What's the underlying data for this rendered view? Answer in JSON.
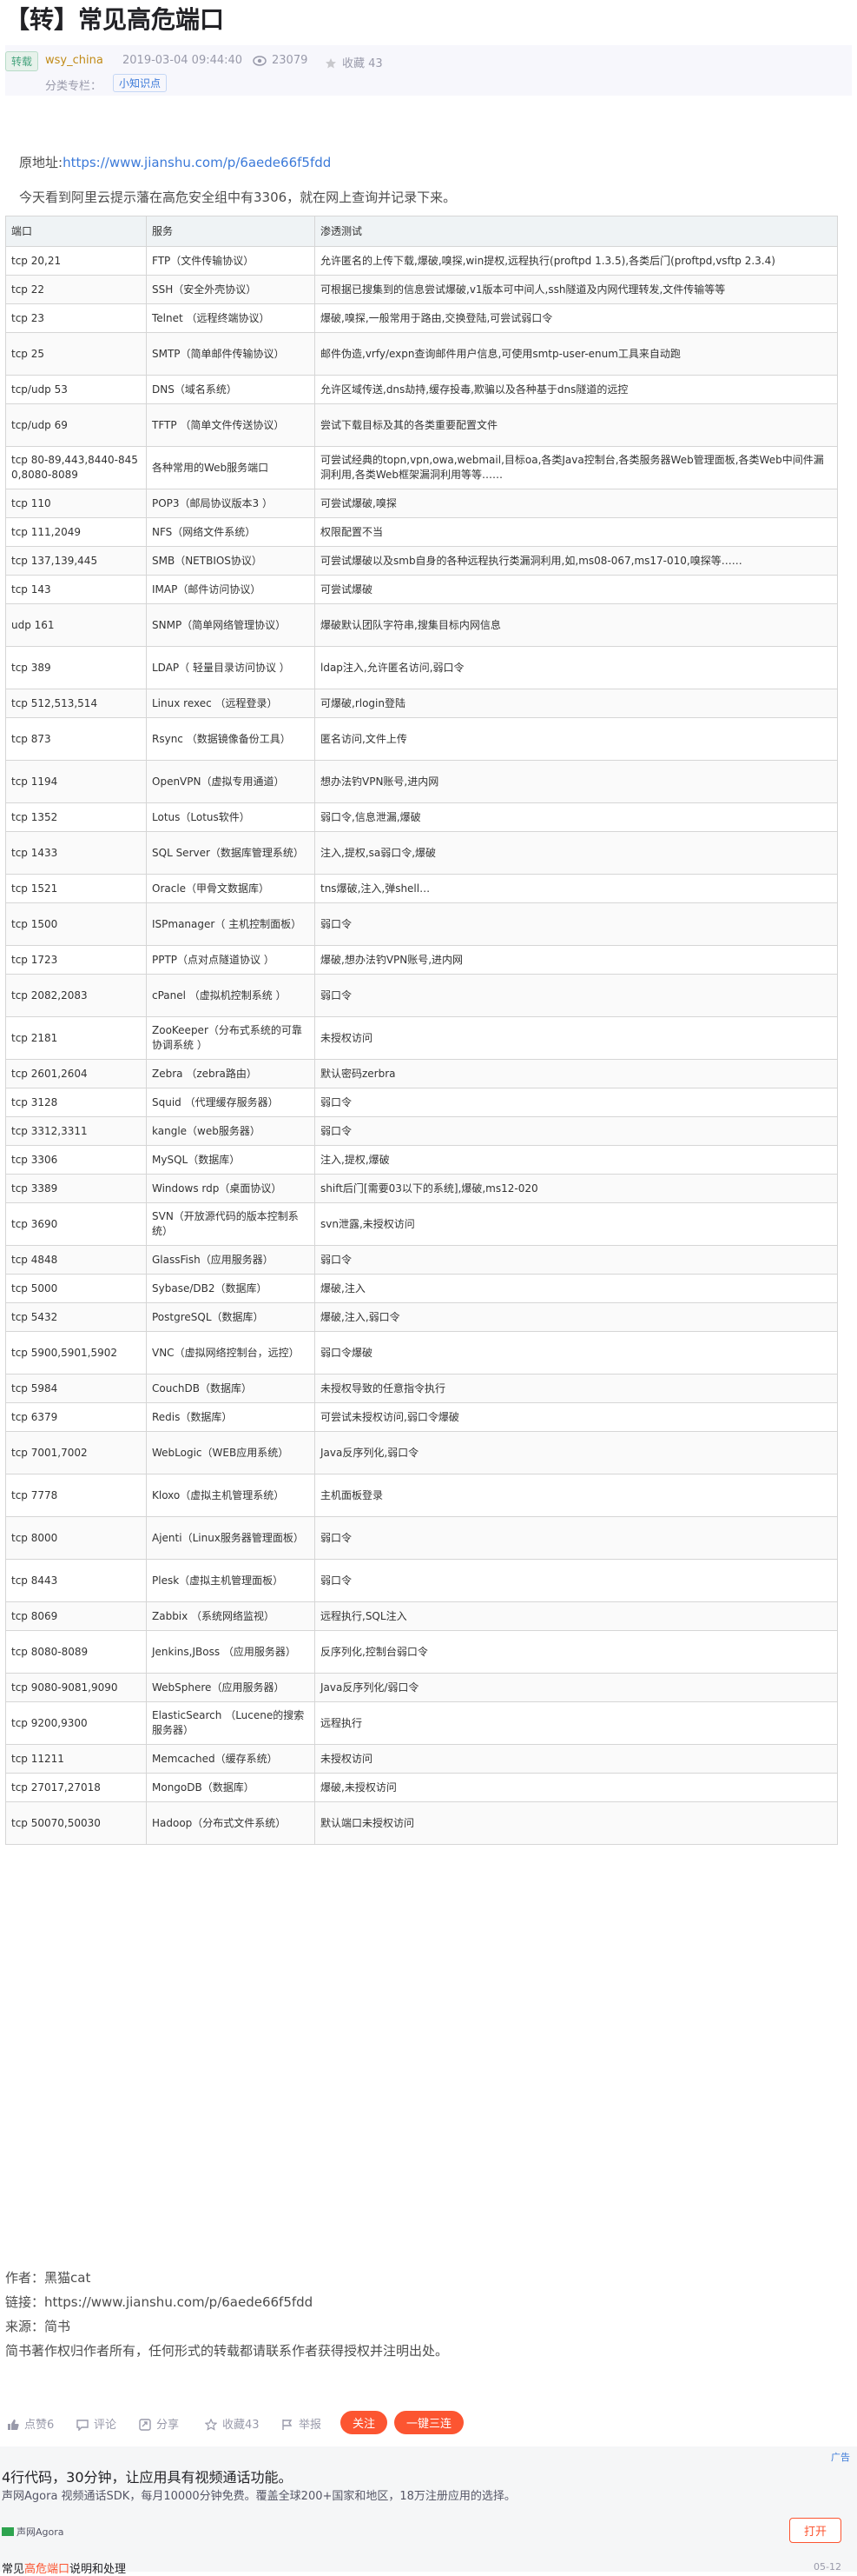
{
  "article": {
    "title": "【转】常见高危端口",
    "tag": "转载",
    "author": "wsy_china",
    "time": "2019-03-04 09:44:40",
    "views": "23079",
    "collect": "收藏 43",
    "column_label": "分类专栏：",
    "column_link": "小知识点",
    "origin_prefix": "原地址:",
    "origin_url": "https://www.jianshu.com/p/6aede66f5fdd",
    "intro": "今天看到阿里云提示藩在高危安全组中有3306，就在网上查询并记录下来。"
  },
  "table": {
    "headers": [
      "端口",
      "服务",
      "渗透测试"
    ],
    "rows": [
      [
        "tcp 20,21",
        "FTP（文件传输协议）",
        "允许匿名的上传下载,爆破,嗅探,win提权,远程执行(proftpd 1.3.5),各类后门(proftpd,vsftp 2.3.4)"
      ],
      [
        "tcp 22",
        "SSH（安全外壳协议）",
        "可根据已搜集到的信息尝试爆破,v1版本可中间人,ssh隧道及内网代理转发,文件传输等等"
      ],
      [
        "tcp 23",
        "Telnet （远程终端协议）",
        "爆破,嗅探,一般常用于路由,交换登陆,可尝试弱口令"
      ],
      [
        "tcp 25",
        "SMTP（简单邮件传输协议）",
        "邮件伪造,vrfy/expn查询邮件用户信息,可使用smtp-user-enum工具来自动跑"
      ],
      [
        "tcp/udp 53",
        "DNS（域名系统）",
        "允许区域传送,dns劫持,缓存投毒,欺骗以及各种基于dns隧道的远控"
      ],
      [
        "tcp/udp 69",
        "TFTP （简单文件传送协议）",
        "尝试下载目标及其的各类重要配置文件"
      ],
      [
        "tcp 80-89,443,8440-8450,8080-8089",
        "各种常用的Web服务端口",
        "可尝试经典的topn,vpn,owa,webmail,目标oa,各类Java控制台,各类服务器Web管理面板,各类Web中间件漏洞利用,各类Web框架漏洞利用等等……"
      ],
      [
        "tcp 110",
        "POP3（邮局协议版本3 ）",
        "可尝试爆破,嗅探"
      ],
      [
        "tcp 111,2049",
        "NFS（网络文件系统）",
        "权限配置不当"
      ],
      [
        "tcp 137,139,445",
        "SMB（NETBIOS协议）",
        "可尝试爆破以及smb自身的各种远程执行类漏洞利用,如,ms08-067,ms17-010,嗅探等……"
      ],
      [
        "tcp 143",
        "IMAP（邮件访问协议）",
        "可尝试爆破"
      ],
      [
        "udp 161",
        "SNMP（简单网络管理协议）",
        "爆破默认团队字符串,搜集目标内网信息"
      ],
      [
        "tcp 389",
        "LDAP（ 轻量目录访问协议 ）",
        "ldap注入,允许匿名访问,弱口令"
      ],
      [
        "tcp 512,513,514",
        "Linux rexec （远程登录）",
        "可爆破,rlogin登陆"
      ],
      [
        "tcp 873",
        "Rsync （数据镜像备份工具）",
        "匿名访问,文件上传"
      ],
      [
        "tcp 1194",
        "OpenVPN（虚拟专用通道）",
        "想办法钓VPN账号,进内网"
      ],
      [
        "tcp 1352",
        "Lotus（Lotus软件）",
        "弱口令,信息泄漏,爆破"
      ],
      [
        "tcp 1433",
        "SQL Server（数据库管理系统）",
        "注入,提权,sa弱口令,爆破"
      ],
      [
        "tcp 1521",
        "Oracle（甲骨文数据库）",
        "tns爆破,注入,弹shell…"
      ],
      [
        "tcp 1500",
        "ISPmanager（ 主机控制面板）",
        "弱口令"
      ],
      [
        "tcp 1723",
        "PPTP（点对点隧道协议 ）",
        "爆破,想办法钓VPN账号,进内网"
      ],
      [
        "tcp 2082,2083",
        "cPanel （虚拟机控制系统 ）",
        "弱口令"
      ],
      [
        "tcp 2181",
        "ZooKeeper（分布式系统的可靠协调系统 ）",
        "未授权访问"
      ],
      [
        "tcp 2601,2604",
        "Zebra （zebra路由）",
        "默认密码zerbra"
      ],
      [
        "tcp 3128",
        "Squid （代理缓存服务器）",
        "弱口令"
      ],
      [
        "tcp 3312,3311",
        "kangle（web服务器）",
        "弱口令"
      ],
      [
        "tcp 3306",
        "MySQL（数据库）",
        "注入,提权,爆破"
      ],
      [
        "tcp 3389",
        "Windows rdp（桌面协议）",
        "shift后门[需要03以下的系统],爆破,ms12-020"
      ],
      [
        "tcp 3690",
        "SVN（开放源代码的版本控制系统）",
        "svn泄露,未授权访问"
      ],
      [
        "tcp 4848",
        "GlassFish（应用服务器）",
        "弱口令"
      ],
      [
        "tcp 5000",
        "Sybase/DB2（数据库）",
        "爆破,注入"
      ],
      [
        "tcp 5432",
        "PostgreSQL（数据库）",
        "爆破,注入,弱口令"
      ],
      [
        "tcp 5900,5901,5902",
        "VNC（虚拟网络控制台，远控）",
        "弱口令爆破"
      ],
      [
        "tcp 5984",
        "CouchDB（数据库）",
        "未授权导致的任意指令执行"
      ],
      [
        "tcp 6379",
        "Redis（数据库）",
        "可尝试未授权访问,弱口令爆破"
      ],
      [
        "tcp 7001,7002",
        "WebLogic（WEB应用系统）",
        "Java反序列化,弱口令"
      ],
      [
        "tcp 7778",
        "Kloxo（虚拟主机管理系统）",
        "主机面板登录"
      ],
      [
        "tcp 8000",
        "Ajenti（Linux服务器管理面板）",
        "弱口令"
      ],
      [
        "tcp 8443",
        "Plesk（虚拟主机管理面板）",
        "弱口令"
      ],
      [
        "tcp 8069",
        "Zabbix （系统网络监视）",
        "远程执行,SQL注入"
      ],
      [
        "tcp 8080-8089",
        "Jenkins,JBoss （应用服务器）",
        "反序列化,控制台弱口令"
      ],
      [
        "tcp 9080-9081,9090",
        "WebSphere（应用服务器）",
        "Java反序列化/弱口令"
      ],
      [
        "tcp 9200,9300",
        "ElasticSearch （Lucene的搜索服务器）",
        "远程执行"
      ],
      [
        "tcp 11211",
        "Memcached（缓存系统）",
        "未授权访问"
      ],
      [
        "tcp 27017,27018",
        "MongoDB（数据库）",
        "爆破,未授权访问"
      ],
      [
        "tcp 50070,50030",
        "Hadoop（分布式文件系统）",
        "默认端口未授权访问"
      ]
    ]
  },
  "footer": {
    "author": "作者：黑猫cat",
    "link": "链接：https://www.jianshu.com/p/6aede66f5fdd",
    "source": "来源：简书",
    "copyright": "简书著作权归作者所有，任何形式的转载都请联系作者获得授权并注明出处。"
  },
  "toolbar": {
    "like": "点赞6",
    "comment": "评论",
    "share": "分享",
    "collect": "收藏43",
    "report": "举报",
    "follow": "关注",
    "triple": "一键三连"
  },
  "ad": {
    "label": "广告",
    "title": "4行代码，30分钟，让应用具有视频通话功能。",
    "desc": "声网Agora 视频通话SDK，每月10000分钟免费。覆盖全球200+国家和地区，18万注册应用的选择。",
    "brand": "声网Agora",
    "open": "打开",
    "next_prefix": "常见",
    "next_hl": "高危端口",
    "next_suffix": "说明和处理",
    "next_date": "05-12"
  },
  "colors": {
    "accent": "#fc5531",
    "link": "#3c7ad9",
    "table_header": "#eff3f5"
  }
}
